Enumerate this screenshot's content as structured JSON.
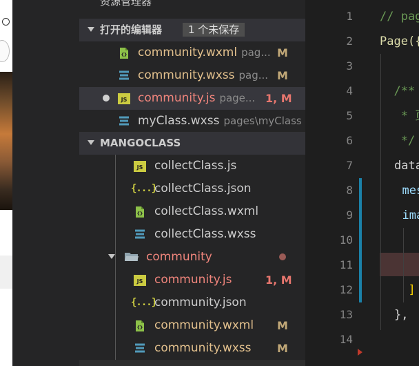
{
  "explorer": {
    "header_label": "资源管理器",
    "open_editors": {
      "title": "打开的编辑器",
      "badge": "1 个未保存",
      "items": [
        {
          "name": "community.wxml",
          "path": "pag...",
          "status": "M",
          "type": "wxml"
        },
        {
          "name": "community.wxss",
          "path": "pag...",
          "status": "M",
          "type": "wxss"
        },
        {
          "name": "community.js",
          "path": "page...",
          "status": "1, M",
          "type": "js",
          "selected": true,
          "unsaved": true
        },
        {
          "name": "myClass.wxss",
          "path": "pages\\myClass",
          "status": "",
          "type": "wxss"
        }
      ]
    },
    "project": {
      "title": "MANGOCLASS",
      "items": [
        {
          "name": "collectClass.js",
          "type": "js"
        },
        {
          "name": "collectClass.json",
          "type": "json"
        },
        {
          "name": "collectClass.wxml",
          "type": "wxml"
        },
        {
          "name": "collectClass.wxss",
          "type": "wxss"
        },
        {
          "name": "community",
          "type": "folder"
        },
        {
          "name": "community.js",
          "type": "js",
          "status": "1, M"
        },
        {
          "name": "community.json",
          "type": "json"
        },
        {
          "name": "community.wxml",
          "type": "wxml",
          "status": "M"
        },
        {
          "name": "community.wxss",
          "type": "wxss",
          "status": "M"
        }
      ]
    }
  },
  "editor": {
    "line_numbers": [
      "1",
      "2",
      "3",
      "4",
      "5",
      "6",
      "7",
      "8",
      "9",
      "10",
      "11",
      "12",
      "13",
      "14"
    ],
    "lines": [
      "// pag",
      "Page({",
      "",
      "  /**",
      "   * 页",
      "   */",
      "data",
      "  mes",
      "  ima",
      "",
      "",
      "  ]",
      "},",
      ""
    ]
  },
  "icons": {
    "js_label": "JS",
    "json_label": "{...}"
  },
  "colors": {
    "panel_bg": "#252526",
    "editor_bg": "#1e1e1e",
    "selection_bg": "#37373d",
    "modified": "#e2c08d",
    "error": "#f0857c",
    "git_modified_bar": "#1b81a8"
  }
}
